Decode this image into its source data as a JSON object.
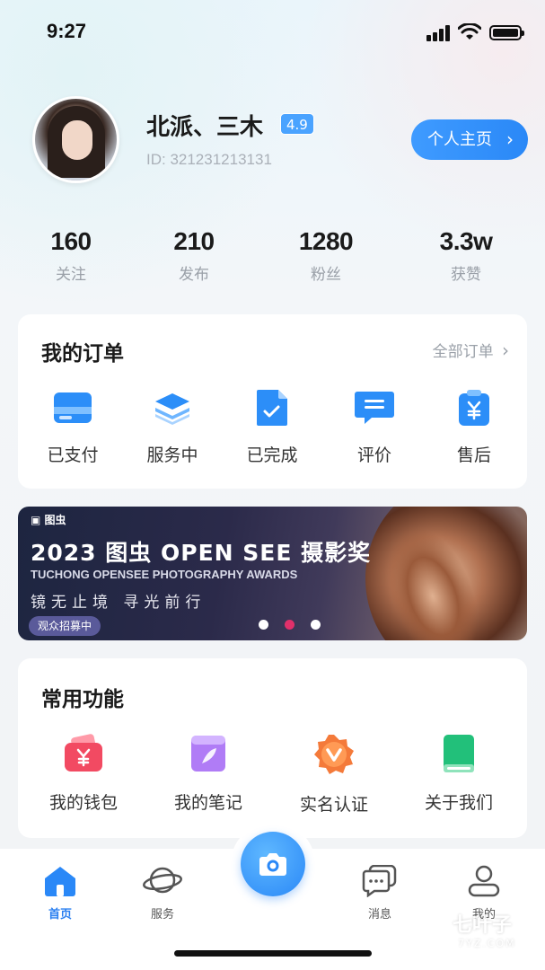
{
  "status_bar": {
    "time": "9:27"
  },
  "profile": {
    "name": "北派、三木",
    "rating": "4.9",
    "id_text": "ID: 321231213131",
    "home_button": "个人主页"
  },
  "stats": [
    {
      "value": "160",
      "label": "关注"
    },
    {
      "value": "210",
      "label": "发布"
    },
    {
      "value": "1280",
      "label": "粉丝"
    },
    {
      "value": "3.3w",
      "label": "获赞"
    }
  ],
  "orders": {
    "title": "我的订单",
    "all_link": "全部订单",
    "items": [
      {
        "label": "已支付",
        "icon": "card-icon"
      },
      {
        "label": "服务中",
        "icon": "layers-icon"
      },
      {
        "label": "已完成",
        "icon": "document-check-icon"
      },
      {
        "label": "评价",
        "icon": "comment-icon"
      },
      {
        "label": "售后",
        "icon": "clipboard-yen-icon"
      }
    ]
  },
  "banner": {
    "logo": "图虫",
    "title": "2023 图虫 OPEN SEE 摄影奖",
    "subtitle": "TUCHONG OPENSEE PHOTOGRAPHY AWARDS",
    "slogan": "镜无止境 寻光前行",
    "tag": "观众招募中",
    "active_dot": 2,
    "dot_count": 3
  },
  "functions": {
    "title": "常用功能",
    "items": [
      {
        "label": "我的钱包",
        "icon": "wallet-icon"
      },
      {
        "label": "我的笔记",
        "icon": "notes-icon"
      },
      {
        "label": "实名认证",
        "icon": "verify-badge-icon"
      },
      {
        "label": "关于我们",
        "icon": "book-icon"
      }
    ]
  },
  "nav": {
    "items": [
      {
        "label": "首页",
        "icon": "home-icon",
        "active": true
      },
      {
        "label": "服务",
        "icon": "planet-icon",
        "active": false
      },
      {
        "label": "消息",
        "icon": "message-icon",
        "active": false
      },
      {
        "label": "我的",
        "icon": "user-icon",
        "active": false
      }
    ],
    "center_icon": "camera-icon"
  },
  "watermark": {
    "text": "七叶子",
    "sub": "7YZ.COM"
  },
  "colors": {
    "accent": "#2a88f7",
    "rating_badge": "#4aa3ff",
    "active_dot": "#e0306a"
  }
}
